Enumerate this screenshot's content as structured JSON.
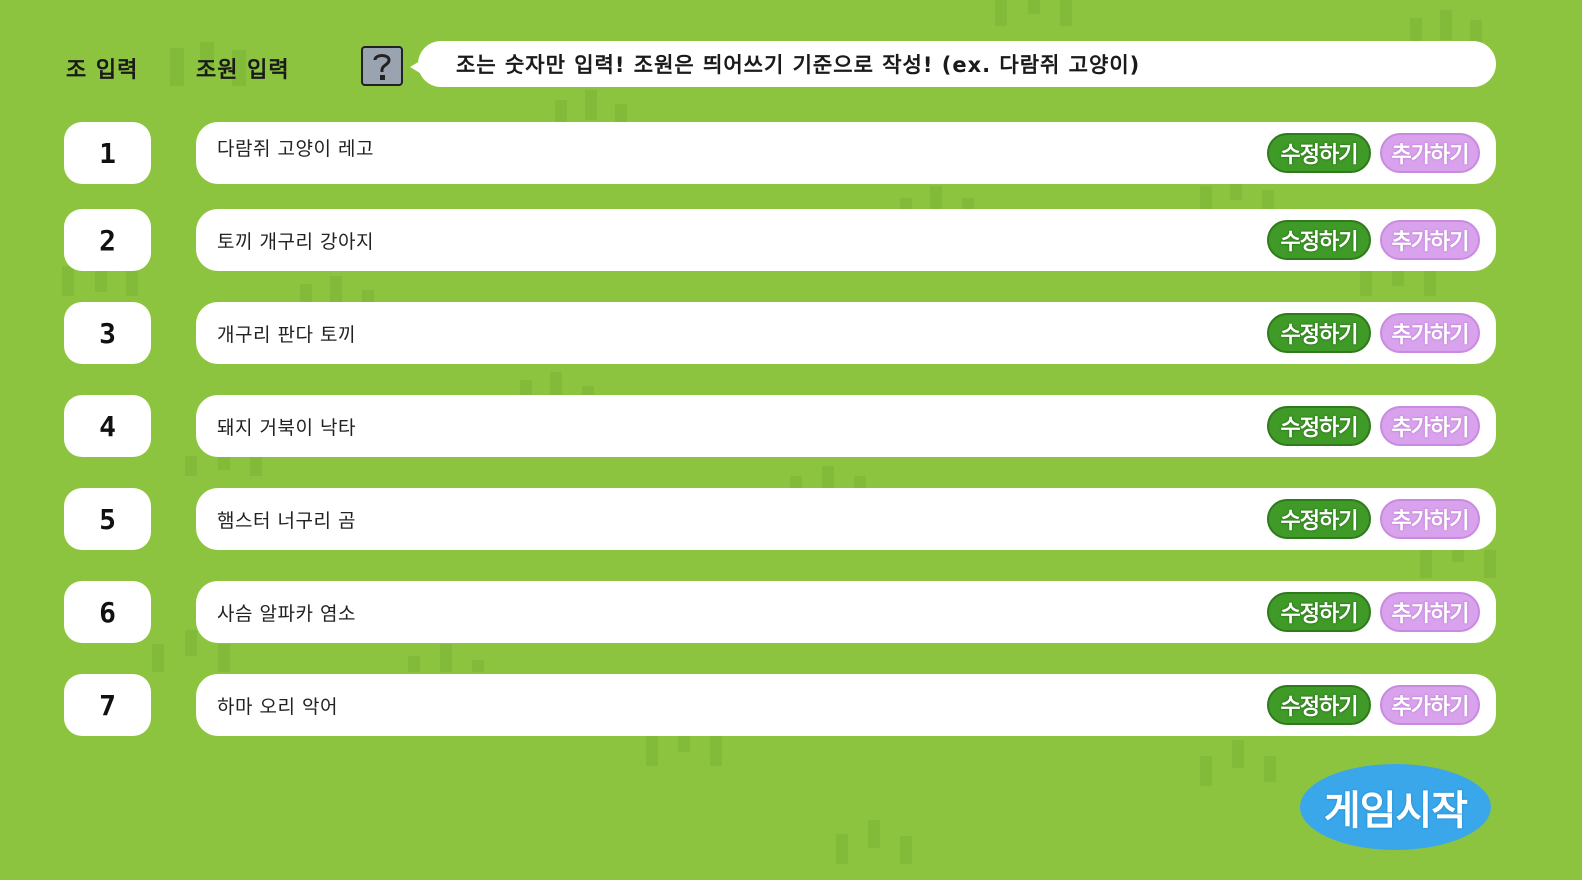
{
  "header": {
    "group_label": "조 입력",
    "members_label": "조원 입력",
    "help_icon": "question-mark-icon",
    "help_text": "조는 숫자만 입력! 조원은 띄어쓰기 기준으로 작성! (ex. 다람쥐 고양이)"
  },
  "rows": [
    {
      "group": "1",
      "members": "다람쥐 고양이 레고",
      "edit_label": "수정하기",
      "add_label": "추가하기"
    },
    {
      "group": "2",
      "members": "토끼 개구리 강아지",
      "edit_label": "수정하기",
      "add_label": "추가하기"
    },
    {
      "group": "3",
      "members": "개구리 판다 토끼",
      "edit_label": "수정하기",
      "add_label": "추가하기"
    },
    {
      "group": "4",
      "members": "돼지 거북이 낙타",
      "edit_label": "수정하기",
      "add_label": "추가하기"
    },
    {
      "group": "5",
      "members": "햄스터 너구리 곰",
      "edit_label": "수정하기",
      "add_label": "추가하기"
    },
    {
      "group": "6",
      "members": "사슴 알파카 염소",
      "edit_label": "수정하기",
      "add_label": "추가하기"
    },
    {
      "group": "7",
      "members": "하마 오리 악어",
      "edit_label": "수정하기",
      "add_label": "추가하기"
    }
  ],
  "start_button": {
    "label": "게임시작"
  },
  "colors": {
    "background": "#8cc43f",
    "edit_button": "#3f9a28",
    "add_button": "#d9a2ec",
    "start_button": "#39a7ea"
  }
}
